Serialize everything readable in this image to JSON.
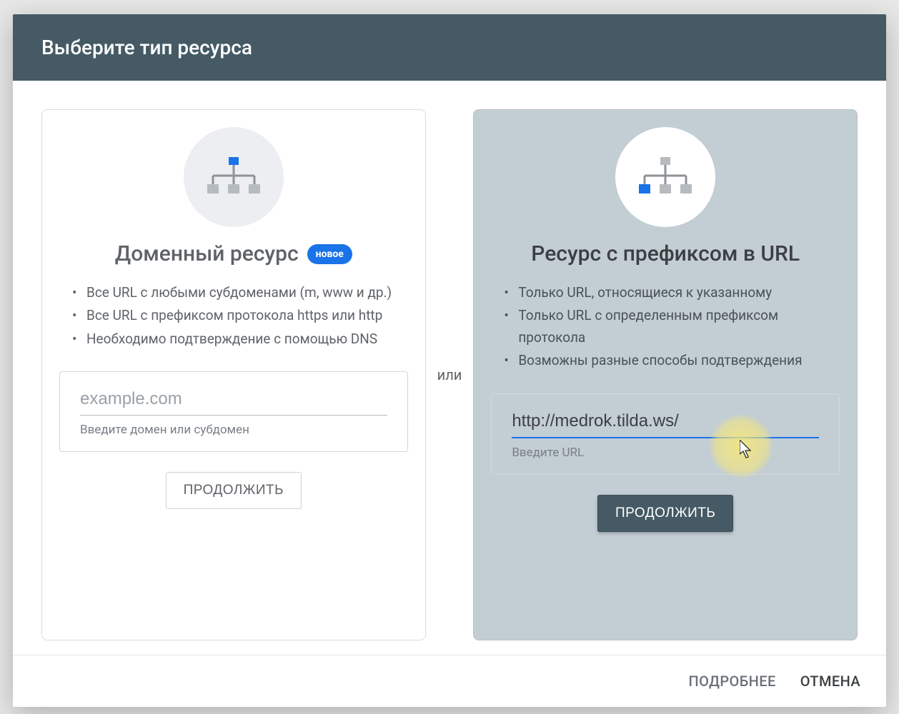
{
  "dialog": {
    "title": "Выберите тип ресурса",
    "separator": "или",
    "footer": {
      "more": "ПОДРОБНЕЕ",
      "cancel": "ОТМЕНА"
    }
  },
  "domain_card": {
    "title": "Доменный ресурс",
    "badge": "новое",
    "bullets": [
      "Все URL с любыми субдоменами (m, www и др.)",
      "Все URL с префиксом протокола https или http",
      "Необходимо подтверждение с помощью DNS"
    ],
    "input_placeholder": "example.com",
    "input_helper": "Введите домен или субдомен",
    "button": "ПРОДОЛЖИТЬ"
  },
  "url_card": {
    "title": "Ресурс с префиксом в URL",
    "bullets": [
      "Только URL, относящиеся к указанному",
      "Только URL с определенным префиксом протокола",
      "Возможны разные способы подтверждения"
    ],
    "input_value": "http://medrok.tilda.ws/",
    "input_helper": "Введите URL",
    "button": "ПРОДОЛЖИТЬ"
  }
}
